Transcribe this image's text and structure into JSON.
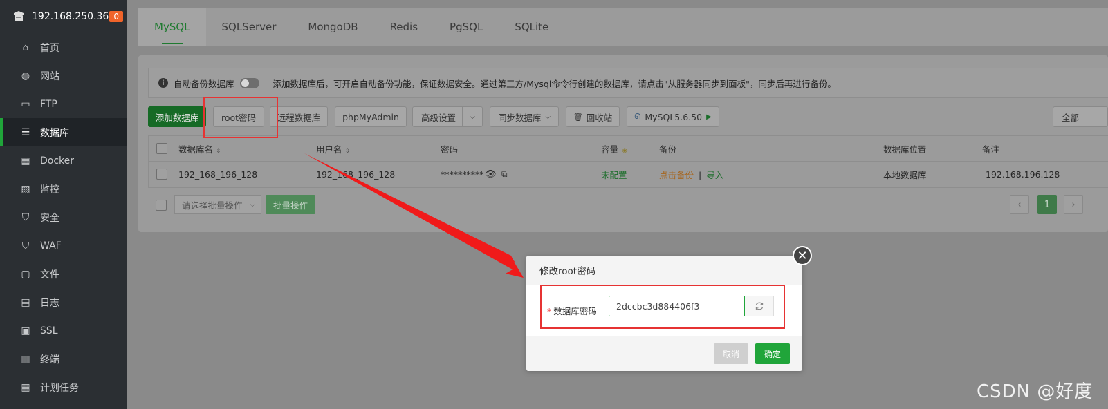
{
  "sidebar": {
    "host": "192.168.250.36",
    "badge": "0",
    "items": [
      {
        "label": "首页",
        "icon": "home-icon"
      },
      {
        "label": "网站",
        "icon": "globe-icon"
      },
      {
        "label": "FTP",
        "icon": "ftp-icon"
      },
      {
        "label": "数据库",
        "icon": "database-icon",
        "active": true
      },
      {
        "label": "Docker",
        "icon": "docker-icon"
      },
      {
        "label": "监控",
        "icon": "monitor-icon"
      },
      {
        "label": "安全",
        "icon": "shield-icon"
      },
      {
        "label": "WAF",
        "icon": "waf-shield-icon"
      },
      {
        "label": "文件",
        "icon": "folder-icon"
      },
      {
        "label": "日志",
        "icon": "log-icon"
      },
      {
        "label": "SSL",
        "icon": "ssl-icon"
      },
      {
        "label": "终端",
        "icon": "terminal-icon"
      },
      {
        "label": "计划任务",
        "icon": "calendar-icon"
      }
    ]
  },
  "tabs": [
    "MySQL",
    "SQLServer",
    "MongoDB",
    "Redis",
    "PgSQL",
    "SQLite"
  ],
  "tip": {
    "toggle_label": "自动备份数据库",
    "text": "添加数据库后，可开启自动备份功能，保证数据安全。通过第三方/Mysql命令行创建的数据库，请点击\"从服务器同步到面板\"，同步后再进行备份。"
  },
  "toolbar": {
    "add_db": "添加数据库",
    "root_pwd": "root密码",
    "remote_db": "远程数据库",
    "phpmyadmin": "phpMyAdmin",
    "advanced": "高级设置",
    "sync_db": "同步数据库",
    "recycle": "回收站",
    "mysql_version": "MySQL5.6.50",
    "filter_all": "全部"
  },
  "table": {
    "headers": [
      "数据库名",
      "用户名",
      "密码",
      "容量",
      "备份",
      "数据库位置",
      "备注"
    ],
    "rows": [
      {
        "name": "192_168_196_128",
        "user": "192_168_196_128",
        "password": "**********",
        "capacity": "未配置",
        "backup_link": "点击备份",
        "import_link": "导入",
        "location": "本地数据库",
        "note": "192.168.196.128"
      }
    ]
  },
  "footer": {
    "batch_select": "请选择批量操作",
    "batch_btn": "批量操作",
    "page": "1"
  },
  "dialog": {
    "title": "修改root密码",
    "label": "数据库密码",
    "value": "2dccbc3d884406f3",
    "cancel": "取消",
    "confirm": "确定"
  },
  "watermark": "CSDN @好度",
  "colors": {
    "accent_green": "#20a53a",
    "annotation_red": "#e63333"
  }
}
